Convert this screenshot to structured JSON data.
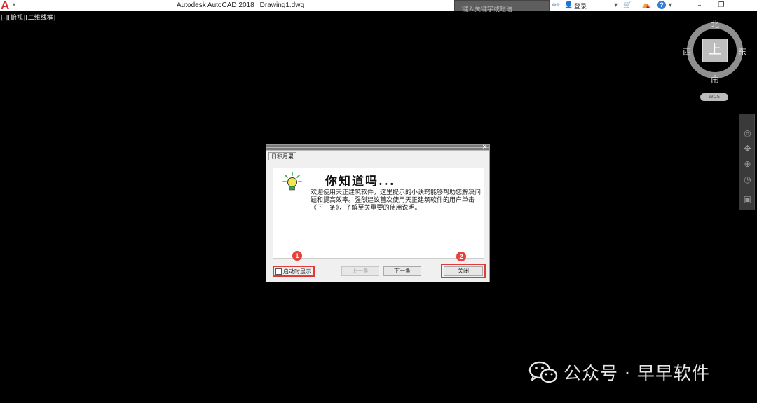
{
  "titlebar": {
    "app_logo_letter": "A",
    "app_logo_caret": "▾",
    "app_name": "Autodesk AutoCAD 2018",
    "document": "Drawing1.dwg",
    "search_placeholder": "键入关键字或短语",
    "binoculars_icon": "👓",
    "user_icon": "👤",
    "login_label": "登录",
    "cart_icon": "🛒",
    "exchange_icon": "⛺",
    "help_label": "?",
    "minimize_glyph": "–",
    "restore_glyph": "❐"
  },
  "viewport": {
    "label": "[-][俯视][二维线框]"
  },
  "viewcube": {
    "north": "北",
    "south": "南",
    "east": "东",
    "west": "西",
    "face": "上",
    "wcs_label": "WCS"
  },
  "navbar": {
    "items": [
      {
        "icon": "full-navigation-wheel-icon",
        "glyph": "◎"
      },
      {
        "icon": "pan-icon",
        "glyph": "✥"
      },
      {
        "icon": "zoom-icon",
        "glyph": "⊕"
      },
      {
        "icon": "orbit-icon",
        "glyph": "◷"
      },
      {
        "icon": "showmotion-icon",
        "glyph": "▣"
      }
    ]
  },
  "dialog": {
    "tab_label": "日积月累",
    "close_glyph": "×",
    "tip_title": "你知道吗...",
    "tip_text": "欢迎使用天正建筑软件，这里提示的小诀窍能够帮助您解决问题和提高效率。强烈建议首次使用天正建筑软件的用户单击《下一条》，了解至关重要的使用说明。",
    "startup_checkbox_label": "启动时显示",
    "startup_checked": false,
    "prev_button": "上一条",
    "next_button": "下一条",
    "close_button": "关闭",
    "marker_1": "1",
    "marker_2": "2"
  },
  "watermark": {
    "text": "公众号 · 早早软件"
  },
  "colors": {
    "background": "#000000",
    "autocad_red": "#d42b2b",
    "marker_red": "#e8413c",
    "highlight_red": "#e03a3a"
  }
}
